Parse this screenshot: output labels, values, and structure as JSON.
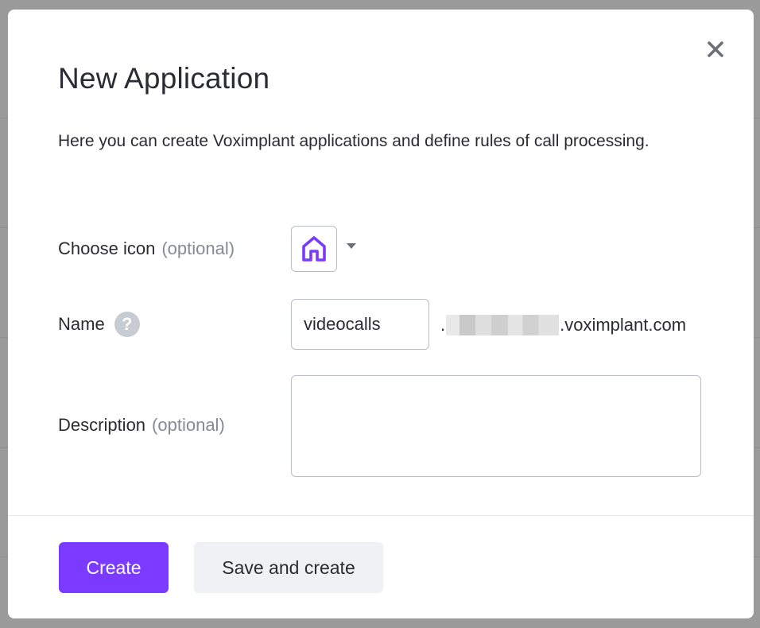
{
  "modal": {
    "title": "New Application",
    "description": "Here you can create Voximplant applications and define rules of call processing."
  },
  "form": {
    "icon_label": "Choose icon",
    "icon_optional": "(optional)",
    "icon_selected": "home-icon",
    "name_label": "Name",
    "name_value": "videocalls",
    "domain_prefix": ".",
    "domain_suffix": ".voximplant.com",
    "description_label": "Description",
    "description_optional": "(optional)",
    "description_value": ""
  },
  "actions": {
    "create_label": "Create",
    "save_create_label": "Save and create"
  },
  "colors": {
    "accent": "#7a3aff",
    "text": "#2b2c33",
    "muted": "#858a93",
    "border": "#b9bec6"
  }
}
